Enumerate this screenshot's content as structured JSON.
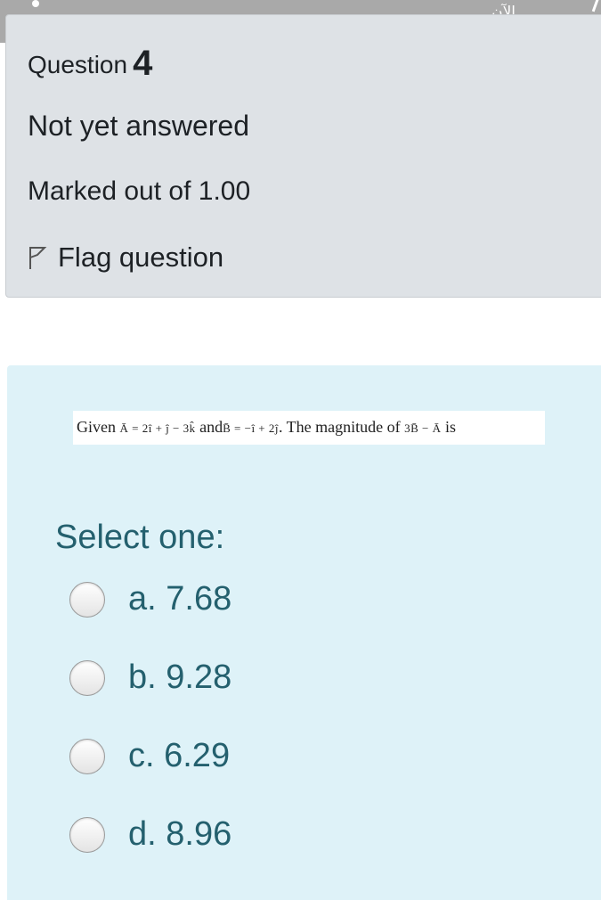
{
  "status_bar": {
    "label": "الآن"
  },
  "info": {
    "question_word": "Question",
    "question_number": "4",
    "state": "Not yet answered",
    "grade": "Marked out of 1.00",
    "flag_label": "Flag question",
    "flag_icon": "flag-outline-icon"
  },
  "question": {
    "text_start": "Given",
    "vector_a": "Ā = 2î + ĵ − 3k̂",
    "text_and": "and",
    "vector_b": "B̄ = −î + 2ĵ",
    "text_mid": ". The magnitude of",
    "expression": "3B̄ − Ā",
    "text_end": "is"
  },
  "prompt": "Select one:",
  "options": [
    {
      "label": "a. 7.68",
      "selected": false
    },
    {
      "label": "b. 9.28",
      "selected": false
    },
    {
      "label": "c. 6.29",
      "selected": false
    },
    {
      "label": "d. 8.96",
      "selected": false
    }
  ],
  "colors": {
    "info_bg": "#dee2e6",
    "content_bg": "#def2f8",
    "option_text": "#24606e",
    "heading_text": "#1d2125"
  }
}
